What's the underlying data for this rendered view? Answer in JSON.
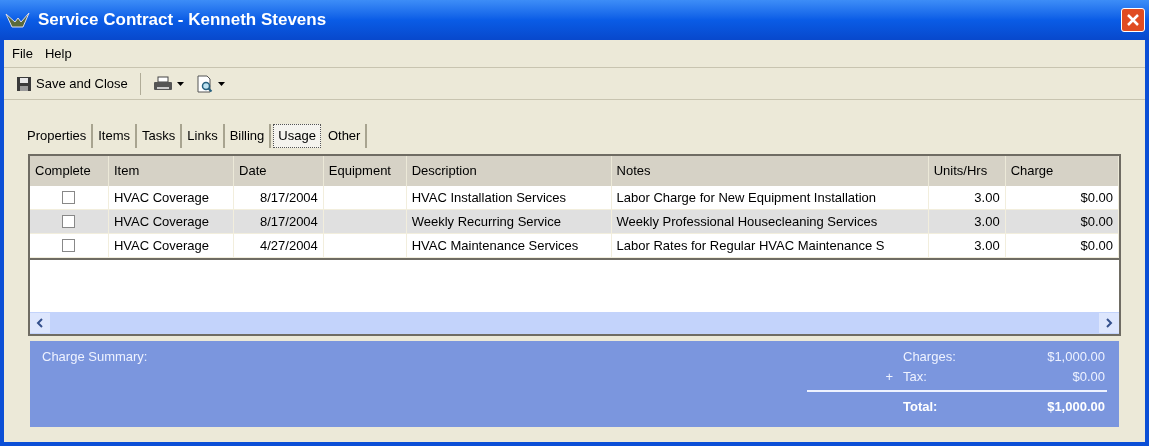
{
  "window": {
    "title": "Service Contract - Kenneth Stevens"
  },
  "menu": [
    "File",
    "Help"
  ],
  "toolbar": [
    {
      "kind": "save",
      "label": "Save and Close"
    },
    {
      "kind": "print"
    },
    {
      "kind": "preview"
    }
  ],
  "tabs": [
    {
      "label": "Properties",
      "selected": false
    },
    {
      "label": "Items",
      "selected": false
    },
    {
      "label": "Tasks",
      "selected": false
    },
    {
      "label": "Links",
      "selected": false
    },
    {
      "label": "Billing",
      "selected": false
    },
    {
      "label": "Usage",
      "selected": true
    },
    {
      "label": "Other",
      "selected": false
    }
  ],
  "table": {
    "columns": [
      "Complete",
      "Item",
      "Date",
      "Equipment",
      "Description",
      "Notes",
      "Units/Hrs",
      "Charge"
    ],
    "rows": [
      {
        "complete": false,
        "item": "HVAC Coverage",
        "date": "8/17/2004",
        "description": "HVAC Installation Services",
        "notes": "Labor Charge for New Equipment Installation",
        "units": "3.00",
        "charge": "$0.00",
        "selected": false
      },
      {
        "complete": false,
        "item": "HVAC Coverage",
        "date": "8/17/2004",
        "description": "Weekly Recurring Service",
        "notes": "Weekly Professional Housecleaning Services",
        "units": "3.00",
        "charge": "$0.00",
        "selected": true
      },
      {
        "complete": false,
        "item": "HVAC Coverage",
        "date": "4/27/2004",
        "description": "HVAC Maintenance Services",
        "notes": "Labor Rates for Regular HVAC Maintenance S",
        "units": "3.00",
        "charge": "$0.00",
        "selected": false
      }
    ]
  },
  "summary": {
    "title": "Charge Summary:",
    "lines": [
      {
        "kind": "line",
        "label": "Charges:",
        "value": "$1,000.00"
      },
      {
        "kind": "line",
        "prefix": "+",
        "label": "Tax:",
        "value": "$0.00"
      },
      {
        "kind": "total",
        "label": "Total:",
        "value": "$1,000.00"
      }
    ]
  }
}
